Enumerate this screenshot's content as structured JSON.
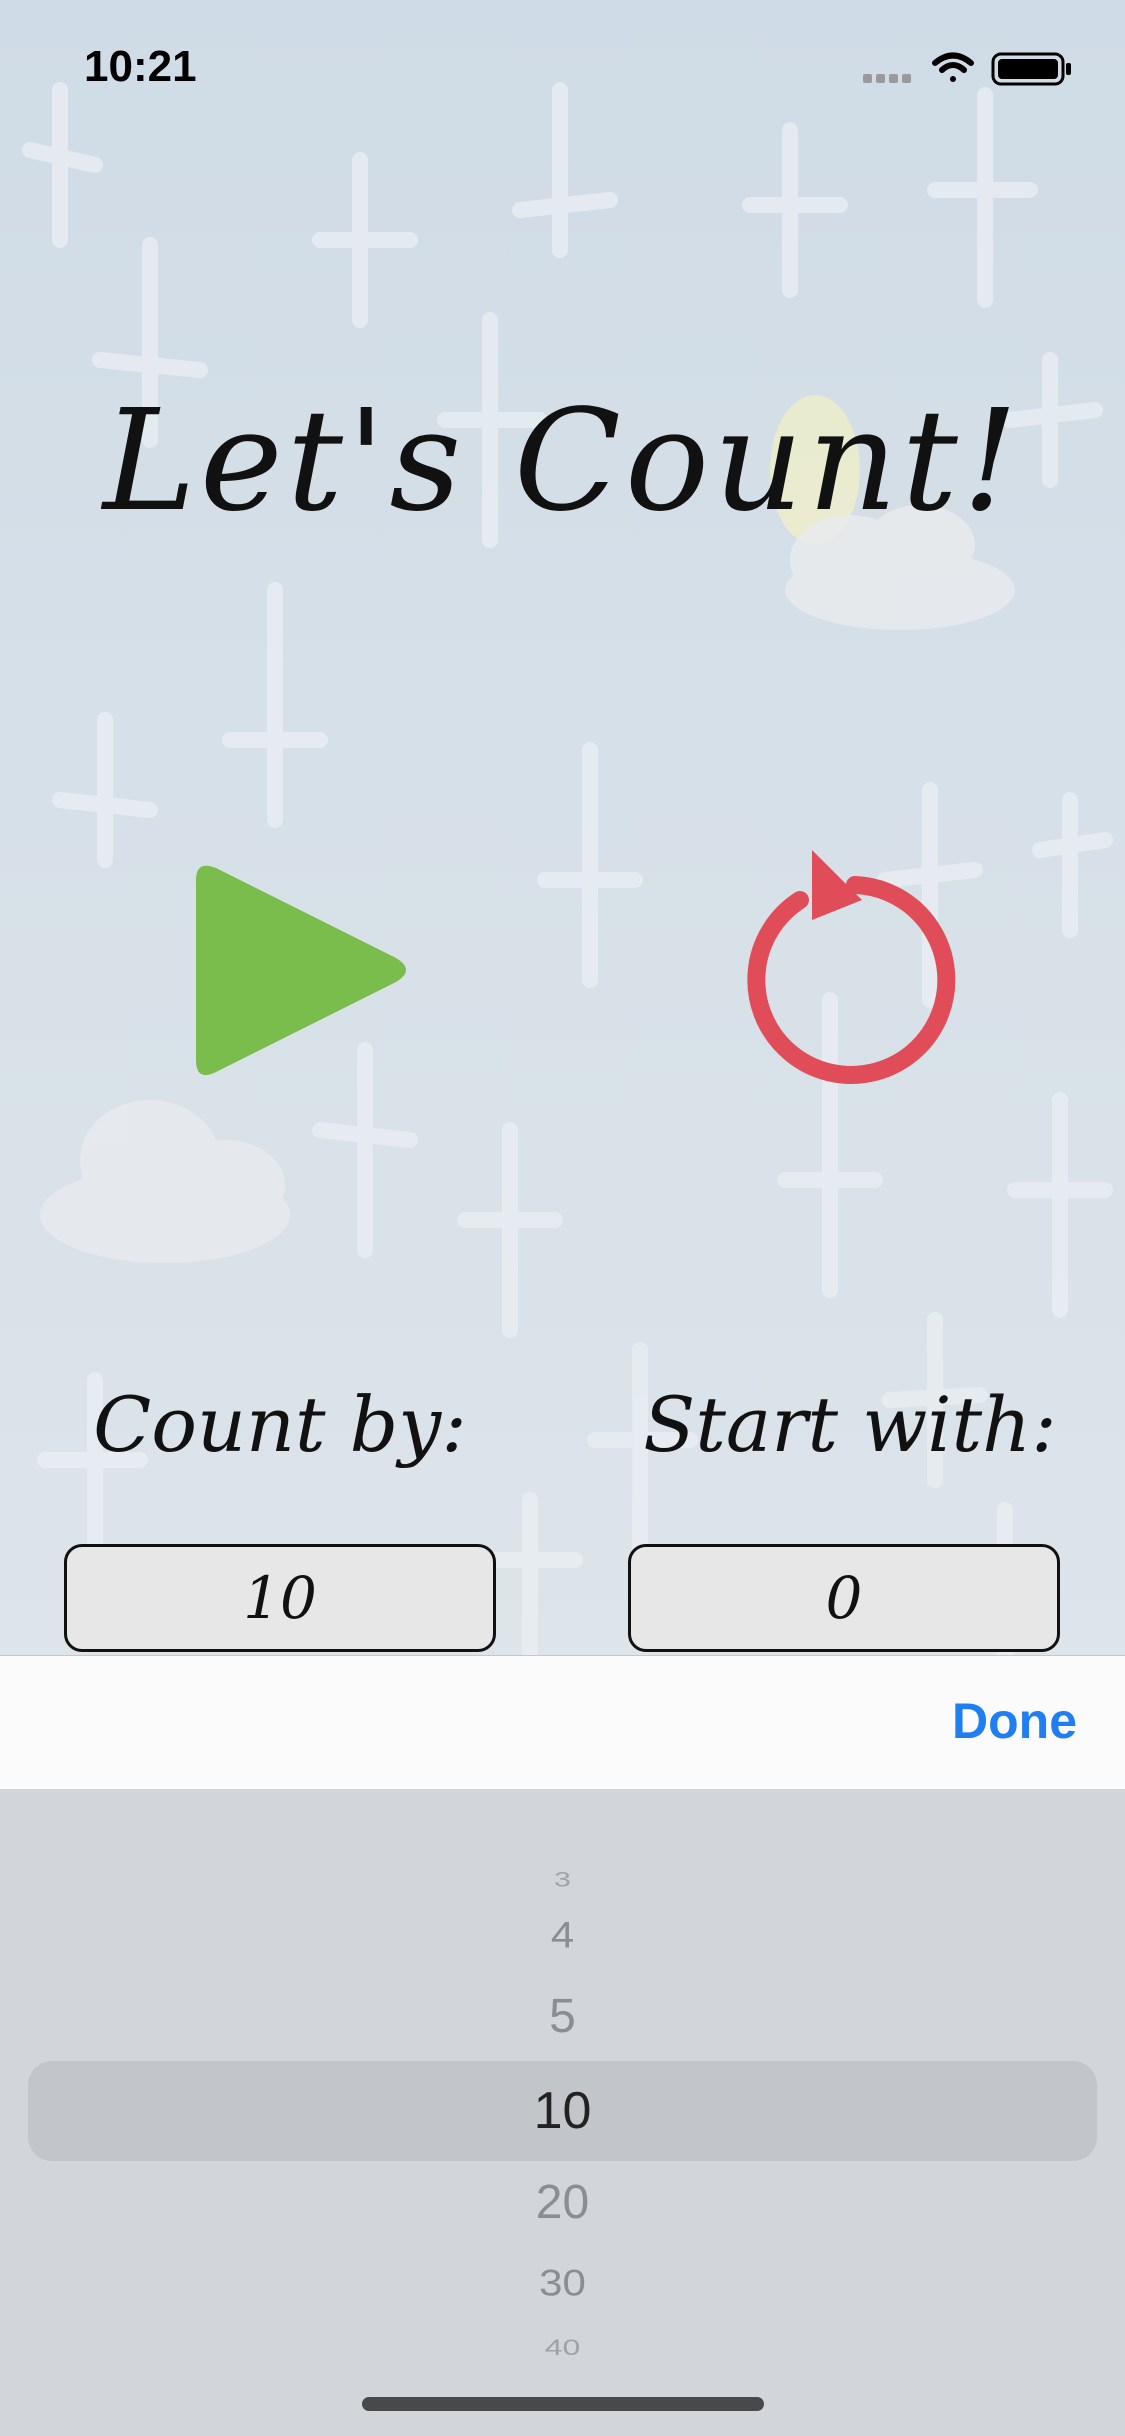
{
  "status_bar": {
    "time": "10:21"
  },
  "title": "Let's Count!",
  "controls": {
    "play_icon": "play-icon",
    "reset_icon": "reset-icon",
    "play_color": "#7bbd4c",
    "reset_color": "#e04c57"
  },
  "count_by": {
    "label": "Count by:",
    "value": "10"
  },
  "start_with": {
    "label": "Start with:",
    "value": "0"
  },
  "toolbar": {
    "done_label": "Done",
    "done_color": "#1f7ef2"
  },
  "picker": {
    "options": [
      "3",
      "4",
      "5",
      "10",
      "20",
      "30",
      "40"
    ],
    "selected": "10"
  }
}
